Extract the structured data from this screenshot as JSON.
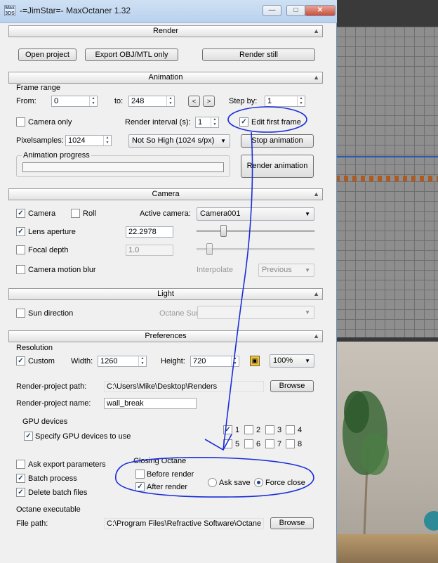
{
  "window": {
    "icon_text": "Max 3DS",
    "title": "-=JimStar=- MaxOctaner 1.32",
    "minimize": "—",
    "maximize": "□",
    "close": "✕"
  },
  "render": {
    "header": "Render",
    "open_project": "Open project",
    "export_obj": "Export OBJ/MTL only",
    "render_still": "Render still"
  },
  "animation": {
    "header": "Animation",
    "frame_range_title": "Frame range",
    "from_label": "From:",
    "from_value": "0",
    "to_label": "to:",
    "to_value": "248",
    "prev": "<",
    "next": ">",
    "step_label": "Step by:",
    "step_value": "1",
    "camera_only": "Camera only",
    "render_interval_label": "Render interval (s):",
    "render_interval_value": "1",
    "edit_first_frame": "Edit first frame",
    "pixelsamples_label": "Pixelsamples:",
    "pixelsamples_value": "1024",
    "quality": "Not So High (1024 s/px)",
    "stop_animation": "Stop animation",
    "progress_title": "Animation progress",
    "render_animation": "Render animation"
  },
  "camera": {
    "header": "Camera",
    "camera_label": "Camera",
    "roll_label": "Roll",
    "active_camera_label": "Active camera:",
    "active_camera_value": "Camera001",
    "lens_aperture_label": "Lens aperture",
    "lens_aperture_value": "22.2978",
    "focal_depth_label": "Focal depth",
    "focal_depth_value": "1.0",
    "motion_blur_label": "Camera motion blur",
    "interpolate_label": "Interpolate",
    "interpolate_value": "Previous"
  },
  "light": {
    "header": "Light",
    "sun_direction": "Sun direction",
    "octane_sun_label": "Octane Sun:"
  },
  "preferences": {
    "header": "Preferences",
    "resolution_title": "Resolution",
    "custom_label": "Custom",
    "width_label": "Width:",
    "width_value": "1260",
    "height_label": "Height:",
    "height_value": "720",
    "scale_value": "100%",
    "project_path_label": "Render-project path:",
    "project_path_value": "C:\\Users\\Mike\\Desktop\\Renders",
    "browse": "Browse",
    "project_name_label": "Render-project name:",
    "project_name_value": "wall_break",
    "gpu_title": "GPU devices",
    "specify_gpu": "Specify GPU devices to use",
    "gpu_labels": [
      "1",
      "2",
      "3",
      "4",
      "5",
      "6",
      "7",
      "8"
    ],
    "ask_export": "Ask export parameters",
    "batch_process": "Batch process",
    "delete_batch": "Delete batch files",
    "closing_title": "Closing Octane",
    "before_render": "Before render",
    "after_render": "After render",
    "ask_save": "Ask save",
    "force_close": "Force close",
    "executable_title": "Octane executable",
    "file_path_label": "File path:",
    "file_path_value": "C:\\Program Files\\Refractive Software\\Octane",
    "browse2": "Browse"
  },
  "colors": {
    "annotation_ink": "#1a2ed8",
    "titlebar": "#c4d8f0"
  }
}
